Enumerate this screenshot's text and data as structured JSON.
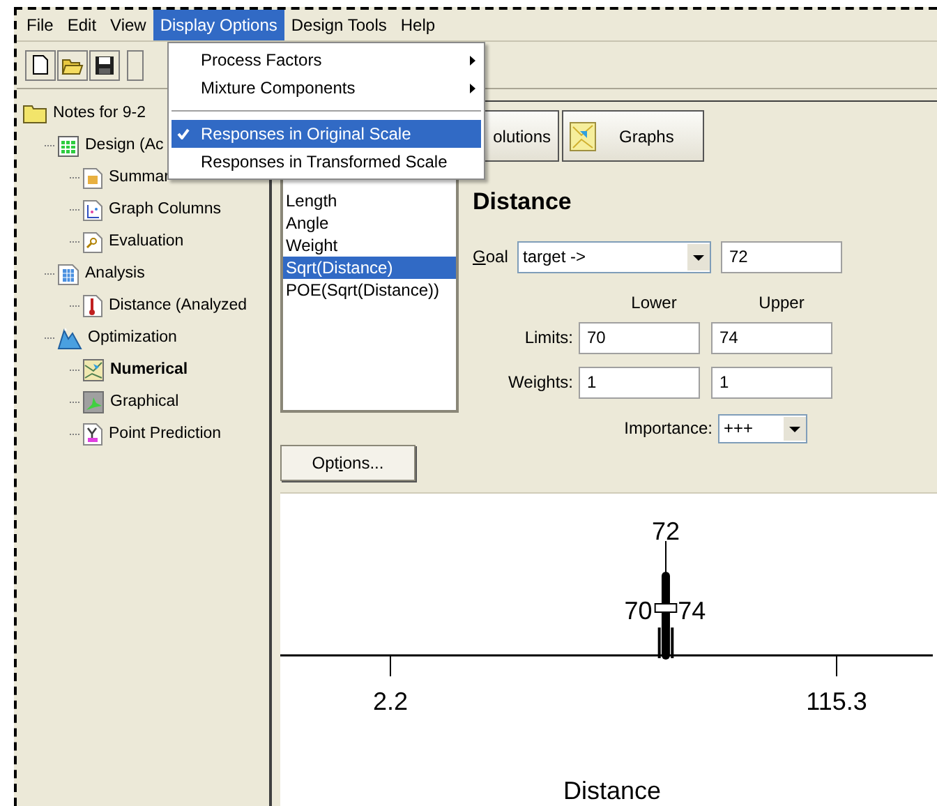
{
  "menu_bar": [
    {
      "label": "File",
      "selected": false
    },
    {
      "label": "Edit",
      "selected": false
    },
    {
      "label": "View",
      "selected": false
    },
    {
      "label": "Display Options",
      "selected": true
    },
    {
      "label": "Design Tools",
      "selected": false
    },
    {
      "label": "Help",
      "selected": false
    }
  ],
  "open_menu": [
    {
      "kind": "submenu",
      "label": "Process Factors",
      "selected": false
    },
    {
      "kind": "submenu",
      "label": "Mixture Components",
      "selected": false
    },
    {
      "kind": "separator"
    },
    {
      "kind": "check",
      "label": "Responses in Original Scale",
      "checked": true,
      "selected": true
    },
    {
      "kind": "check",
      "label": "Responses in Transformed Scale",
      "checked": false,
      "selected": false
    }
  ],
  "tree": [
    {
      "label": "Notes for 9-2",
      "selected": false,
      "children": [
        {
          "label": "Design (Ac",
          "selected": false,
          "children": [
            {
              "label": "Summar",
              "selected": false
            },
            {
              "label": "Graph Columns",
              "selected": false
            },
            {
              "label": "Evaluation",
              "selected": false
            }
          ]
        },
        {
          "label": "Analysis",
          "selected": false,
          "children": [
            {
              "label": "Distance (Analyzed",
              "selected": false
            }
          ]
        },
        {
          "label": "Optimization",
          "selected": false,
          "children": [
            {
              "label": "Numerical",
              "selected": true
            },
            {
              "label": "Graphical",
              "selected": false
            },
            {
              "label": "Point Prediction",
              "selected": false
            }
          ]
        }
      ]
    }
  ],
  "view_buttons": [
    {
      "label": "olutions"
    },
    {
      "label": "Graphs"
    }
  ],
  "responses": [
    {
      "label": "Length",
      "selected": false
    },
    {
      "label": "Angle",
      "selected": false
    },
    {
      "label": "Weight",
      "selected": false
    },
    {
      "label": "Sqrt(Distance)",
      "selected": true
    },
    {
      "label": "POE(Sqrt(Distance))",
      "selected": false
    }
  ],
  "options_button": {
    "label": "Options..."
  },
  "heading": "Distance",
  "goal": {
    "label": "Goal",
    "value": "target ->",
    "target": "72"
  },
  "column_headers": [
    "Lower",
    "Upper"
  ],
  "limits": {
    "label": "Limits:",
    "lower": "70",
    "upper": "74"
  },
  "weights": {
    "label": "Weights:",
    "lower": "1",
    "upper": "1"
  },
  "importance": {
    "label": "Importance:",
    "value": "+++"
  },
  "ramp": {
    "axis_label": "Distance",
    "min_tick": "2.2",
    "max_tick": "115.3",
    "target": "72",
    "lower": "70",
    "upper": "74"
  }
}
